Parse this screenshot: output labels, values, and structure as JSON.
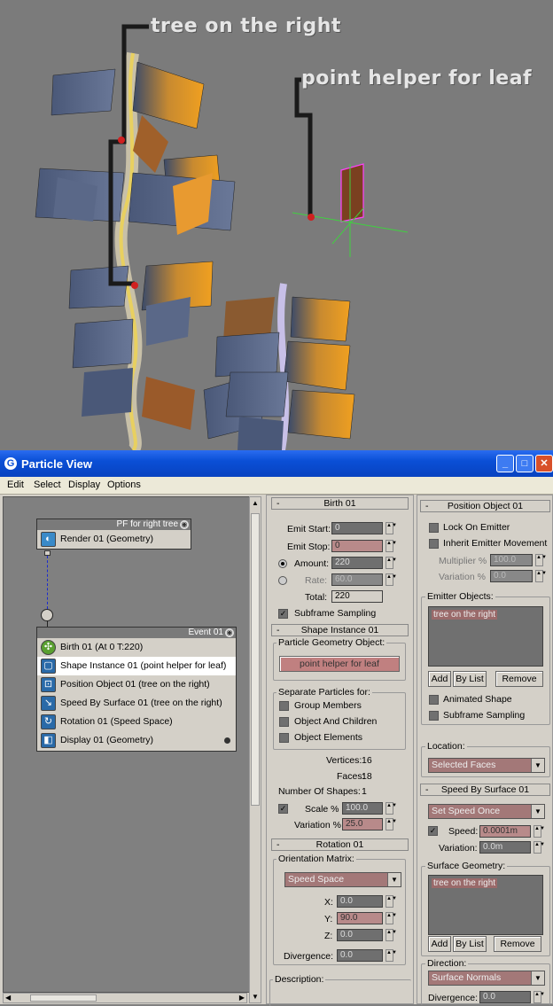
{
  "viewport": {
    "annotation_tree": "tree on the right",
    "annotation_point": "point helper for leaf"
  },
  "window": {
    "title": "Particle View",
    "menu": [
      "Edit",
      "Select",
      "Display",
      "Options"
    ]
  },
  "graph": {
    "global_node": {
      "title": "PF for right tree",
      "operator": "Render 01 (Geometry)"
    },
    "event_node": {
      "title": "Event 01",
      "operators": [
        {
          "label": "Birth 01 (At 0 T:220)",
          "icon": "birth-icon"
        },
        {
          "label": "Shape Instance 01 (point helper for leaf)",
          "icon": "shape-instance-icon"
        },
        {
          "label": "Position Object 01 (tree on the right)",
          "icon": "position-object-icon"
        },
        {
          "label": "Speed By Surface 01 (tree on the right)",
          "icon": "speed-surface-icon"
        },
        {
          "label": "Rotation 01 (Speed Space)",
          "icon": "rotation-icon"
        },
        {
          "label": "Display 01 (Geometry)",
          "icon": "display-icon"
        }
      ]
    }
  },
  "birth": {
    "title": "Birth 01",
    "emit_start_label": "Emit Start:",
    "emit_start": "0",
    "emit_stop_label": "Emit Stop:",
    "emit_stop": "0",
    "amount_label": "Amount:",
    "amount": "220",
    "rate_label": "Rate:",
    "rate": "60.0",
    "total_label": "Total:",
    "total": "220",
    "subframe_label": "Subframe Sampling"
  },
  "shape_instance": {
    "title": "Shape Instance 01",
    "geom_group": "Particle Geometry Object:",
    "geom_button": "point helper for leaf",
    "separate_group": "Separate Particles for:",
    "group_members": "Group Members",
    "object_children": "Object And Children",
    "object_elements": "Object Elements",
    "vertices_label": "Vertices:",
    "vertices": "16",
    "faces_label": "Faces:",
    "faces": "18",
    "num_shapes_label": "Number Of Shapes:",
    "num_shapes": "1",
    "scale_label": "Scale %",
    "scale": "100.0",
    "variation_label": "Variation %",
    "variation": "25.0"
  },
  "rotation": {
    "title": "Rotation 01",
    "matrix_group": "Orientation Matrix:",
    "matrix_value": "Speed Space",
    "x_label": "X:",
    "x": "0.0",
    "y_label": "Y:",
    "y": "90.0",
    "z_label": "Z:",
    "z": "0.0",
    "divergence_label": "Divergence:",
    "divergence": "0.0"
  },
  "description_label": "Description:",
  "position_object": {
    "title": "Position Object 01",
    "lock_label": "Lock On Emitter",
    "inherit_label": "Inherit Emitter Movement",
    "multiplier_label": "Multiplier %",
    "multiplier": "100.0",
    "variation_label": "Variation %",
    "variation": "0.0",
    "emitter_group": "Emitter Objects:",
    "emitter_item": "tree on the right",
    "add": "Add",
    "bylist": "By List",
    "remove": "Remove",
    "animated_shape": "Animated Shape",
    "subframe": "Subframe Sampling",
    "location_group": "Location:",
    "location_value": "Selected Faces"
  },
  "speed_surface": {
    "title": "Speed By Surface 01",
    "mode_value": "Set Speed Once",
    "speed_label": "Speed:",
    "speed": "0.0001m",
    "variation_label": "Variation:",
    "variation": "0.0m",
    "surface_group": "Surface Geometry:",
    "surface_item": "tree on the right",
    "add": "Add",
    "bylist": "By List",
    "remove": "Remove",
    "direction_group": "Direction:",
    "direction_value": "Surface Normals",
    "divergence_label": "Divergence:",
    "divergence": "0.0"
  }
}
